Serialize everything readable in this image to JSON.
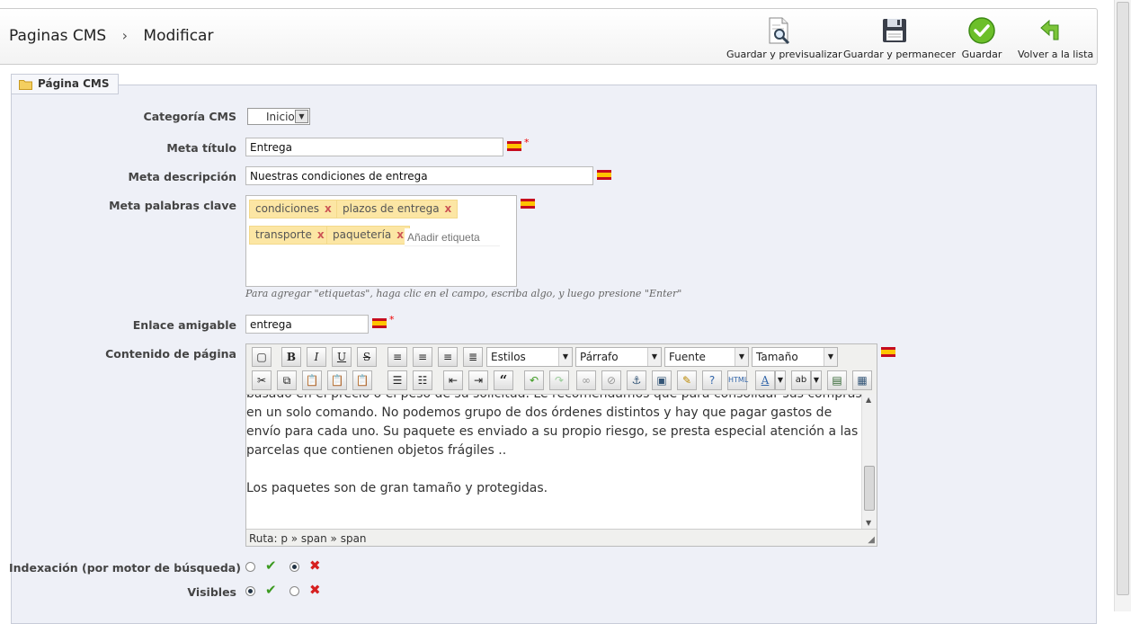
{
  "header": {
    "breadcrumb": [
      "Paginas CMS",
      "Modificar"
    ],
    "separator": "›",
    "actions": [
      {
        "label": "Guardar y previsualizar",
        "icon": "preview-icon"
      },
      {
        "label": "Guardar y permanecer",
        "icon": "floppy-disk-icon"
      },
      {
        "label": "Guardar",
        "icon": "check-circle-icon"
      },
      {
        "label": "Volver a la lista",
        "icon": "back-arrow-icon"
      }
    ]
  },
  "section": {
    "legend": "Página CMS"
  },
  "form": {
    "category": {
      "label": "Categoría CMS",
      "value": "Inicio"
    },
    "meta_title": {
      "label": "Meta título",
      "value": "Entrega"
    },
    "meta_description": {
      "label": "Meta descripción",
      "value": "Nuestras condiciones de entrega"
    },
    "meta_keywords": {
      "label": "Meta palabras clave",
      "tags": [
        "condiciones",
        "plazos de entrega",
        "transporte",
        "paquetería"
      ],
      "tag_remove": "x",
      "placeholder": "Añadir etiqueta",
      "hint": "Para agregar \"etiquetas\", haga clic en el campo, escriba algo, y luego presione \"Enter\""
    },
    "friendly_url": {
      "label": "Enlace amigable",
      "value": "entrega"
    },
    "content": {
      "label": "Contenido de página",
      "toolbar": {
        "styles": "Estilos",
        "format": "Párrafo",
        "font": "Fuente",
        "size": "Tamaño"
      },
      "paragraphs": [
        "basado en el precio o el peso de su solicitud. Le recomendamos que para consolidar sus compras en un solo comando. No podemos grupo de dos órdenes distintos y hay que pagar gastos de envío para cada uno. Su paquete es enviado a su propio riesgo, se presta especial atención a las parcelas que contienen objetos frágiles ..",
        "Los paquetes son de gran tamaño y protegidas."
      ],
      "path": "Ruta: p » span » span"
    },
    "indexation": {
      "label": "Indexación (por motor de búsqueda)",
      "value": "no"
    },
    "visible": {
      "label": "Visibles",
      "value": "yes"
    }
  },
  "required_mark": "*",
  "colors": {
    "accent": "#3c9a20",
    "error": "#d62020",
    "tag_bg": "#fce6a4",
    "panel_bg": "#eef0f7"
  }
}
